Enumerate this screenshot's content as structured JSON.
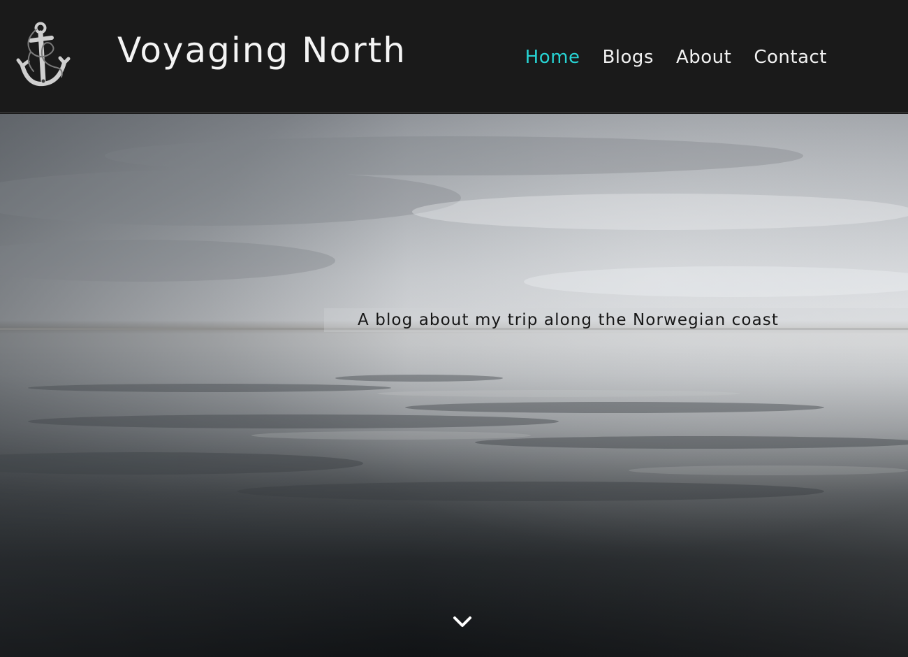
{
  "brand": {
    "title": "Voyaging North",
    "logo_icon": "anchor-icon"
  },
  "nav": {
    "items": [
      {
        "label": "Home",
        "active": true
      },
      {
        "label": "Blogs",
        "active": false
      },
      {
        "label": "About",
        "active": false
      },
      {
        "label": "Contact",
        "active": false
      }
    ]
  },
  "hero": {
    "tagline": "A blog about my trip along the Norwegian coast",
    "scroll_icon": "chevron-down-icon"
  },
  "colors": {
    "header_bg": "#1a1a1a",
    "nav_active": "#27d3d3",
    "nav_text": "#f2f2f2"
  }
}
